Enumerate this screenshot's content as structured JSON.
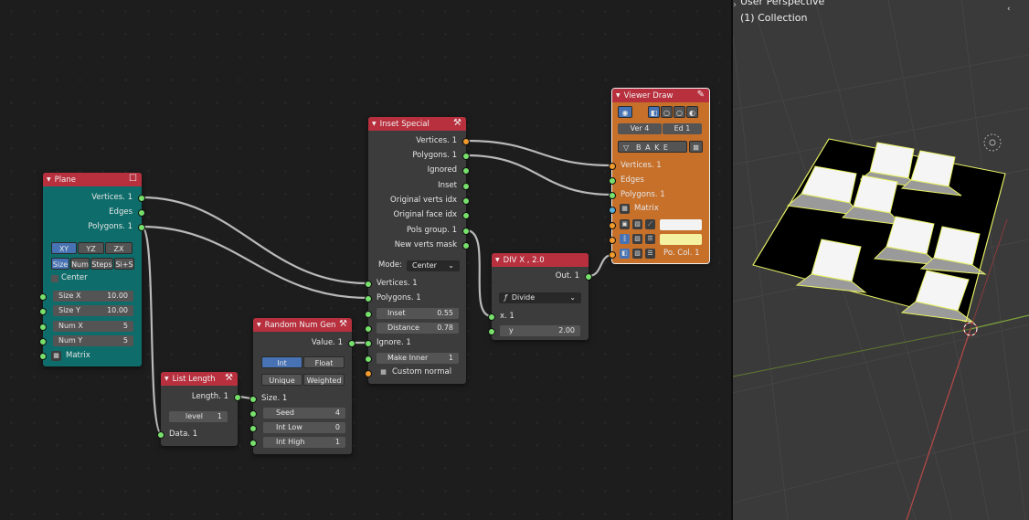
{
  "viewport": {
    "title": "User Perspective",
    "collection": "(1) Collection"
  },
  "plane": {
    "title": "Plane",
    "outputs": [
      "Vertices. 1",
      "Edges",
      "Polygons. 1"
    ],
    "axes": [
      {
        "label": "XY",
        "active": true
      },
      {
        "label": "YZ",
        "active": false
      },
      {
        "label": "ZX",
        "active": false
      }
    ],
    "modes": [
      "Size",
      "Num",
      "Steps",
      "Si+S"
    ],
    "center_label": "Center",
    "fields": [
      {
        "label": "Size X",
        "value": "10.00"
      },
      {
        "label": "Size Y",
        "value": "10.00"
      },
      {
        "label": "Num X",
        "value": "5"
      },
      {
        "label": "Num Y",
        "value": "5"
      }
    ],
    "matrix_label": "Matrix"
  },
  "list_length": {
    "title": "List Length",
    "output": "Length. 1",
    "level_label": "level",
    "level_value": "1",
    "input": "Data. 1"
  },
  "random": {
    "title": "Random Num Gen",
    "output": "Value. 1",
    "type_opts": [
      {
        "label": "Int",
        "active": true
      },
      {
        "label": "Float",
        "active": false
      }
    ],
    "mode_opts": [
      "Unique",
      "Weighted"
    ],
    "size_label": "Size. 1",
    "fields": [
      {
        "label": "Seed",
        "value": "4"
      },
      {
        "label": "Int Low",
        "value": "0"
      },
      {
        "label": "Int High",
        "value": "1"
      }
    ]
  },
  "inset": {
    "title": "Inset Special",
    "outputs": [
      "Vertices. 1",
      "Polygons. 1",
      "Ignored",
      "Inset",
      "Original verts idx",
      "Original face idx",
      "Pols group. 1",
      "New verts mask"
    ],
    "mode_label": "Mode:",
    "mode_value": "Center",
    "inputs": [
      "Vertices. 1",
      "Polygons. 1"
    ],
    "fields": [
      {
        "label": "Inset",
        "value": "0.55"
      },
      {
        "label": "Distance",
        "value": "0.78"
      }
    ],
    "ignore": "Ignore. 1",
    "make_inner": {
      "label": "Make Inner",
      "value": "1"
    },
    "custom_normal": "Custom normal"
  },
  "div": {
    "title": "DIV X , 2.0",
    "output": "Out. 1",
    "op": "Divide",
    "x_label": "x. 1",
    "y": {
      "label": "y",
      "value": "2.00"
    }
  },
  "viewer": {
    "title": "Viewer Draw",
    "ver": "Ver 4",
    "ed": "Ed  1",
    "bake": "B A K E",
    "inputs": [
      "Vertices. 1",
      "Edges",
      "Polygons. 1",
      "Matrix"
    ],
    "pocol": "Po. Col. 1",
    "swatch1": "#f3f3f3",
    "swatch2": "#f4f1a0"
  },
  "colors": {
    "red_header": "#b8303e",
    "teal": "#0e6d6b",
    "orange": "#c7702a",
    "active": "#4772b3"
  }
}
